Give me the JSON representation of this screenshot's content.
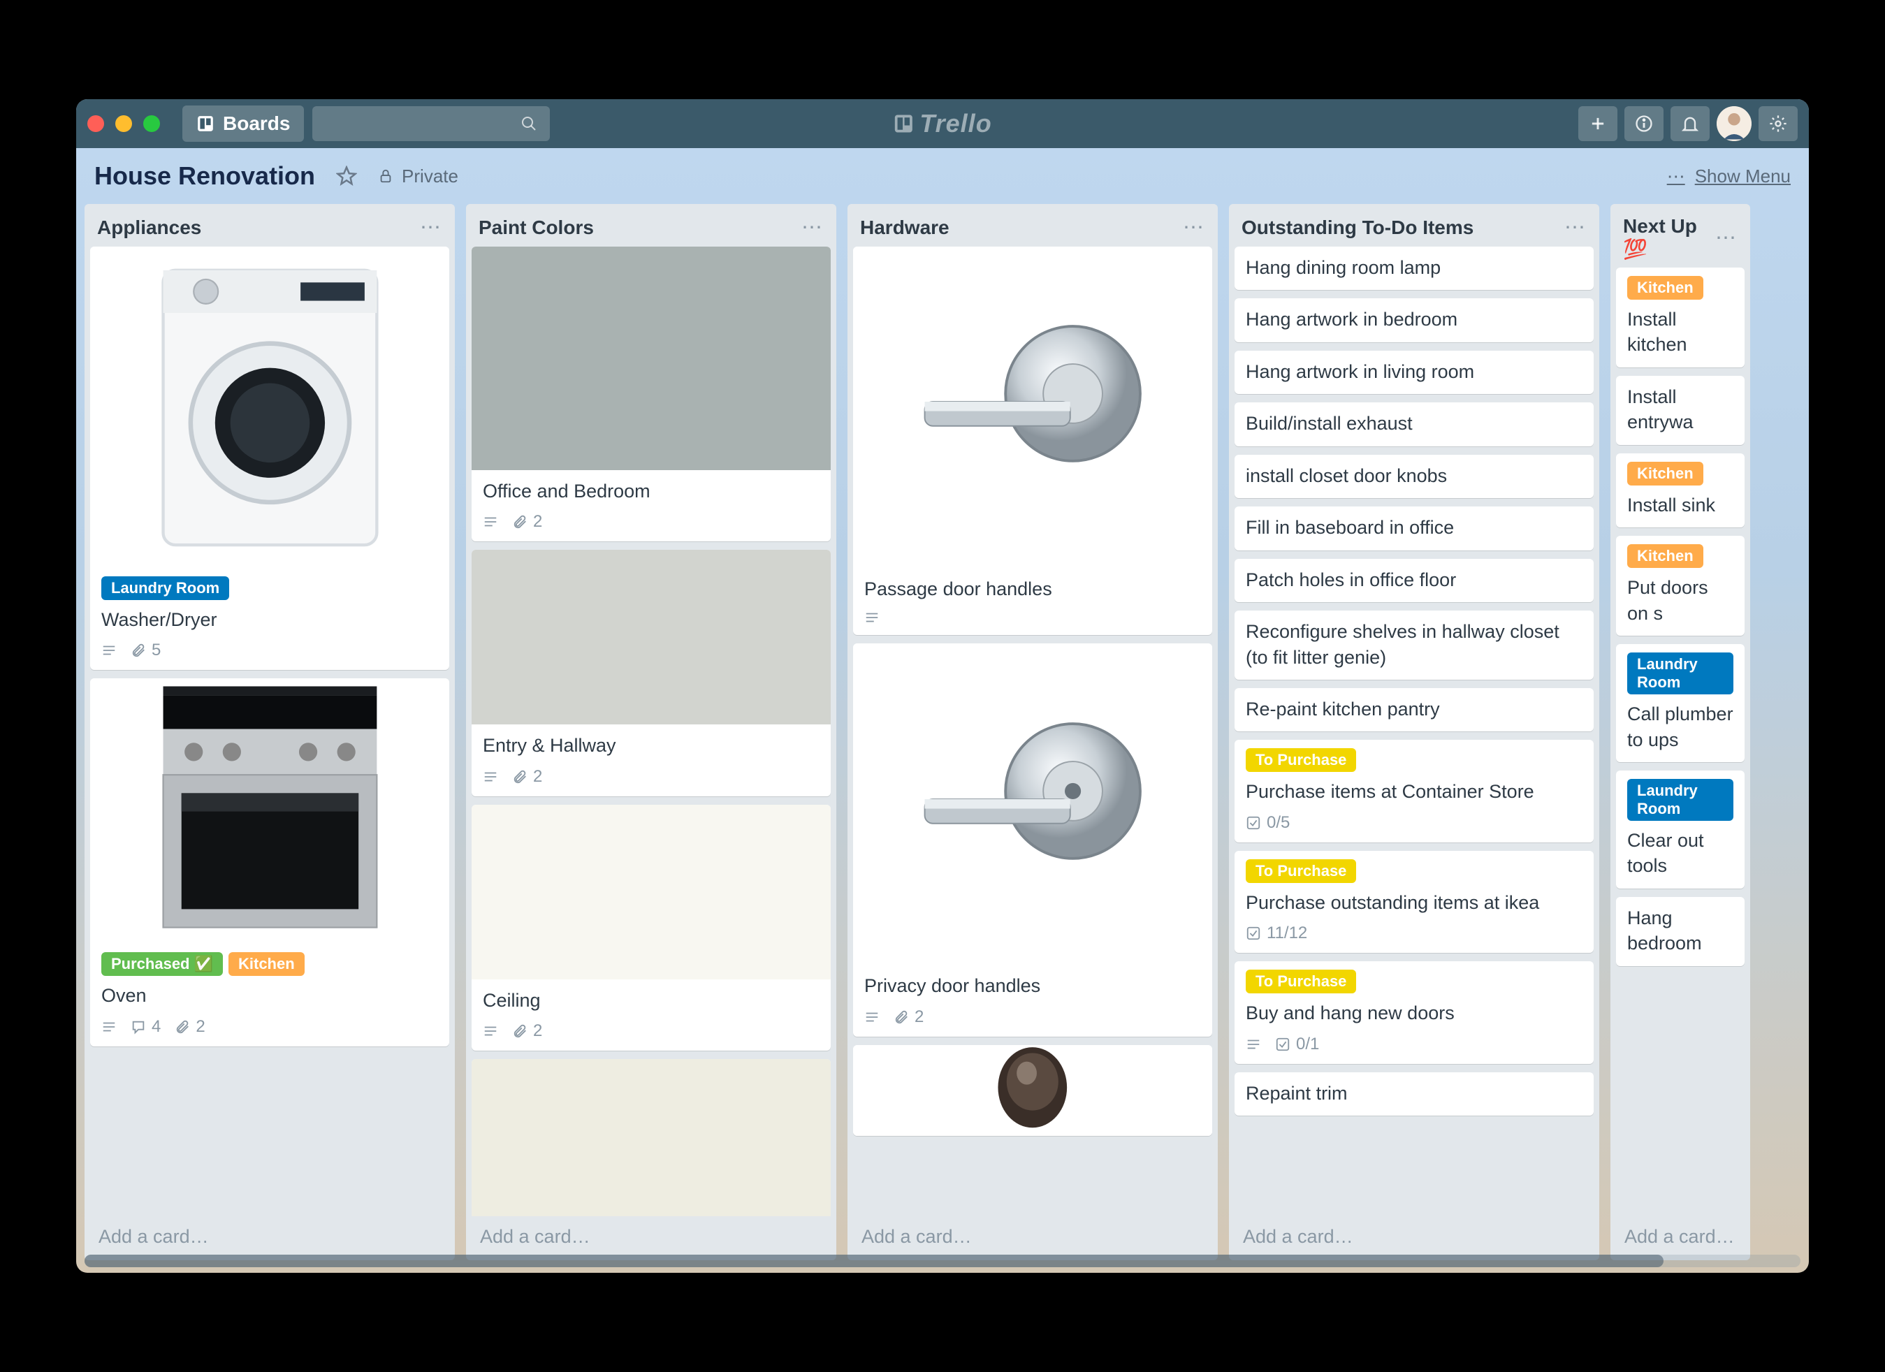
{
  "header": {
    "boards_label": "Boards",
    "logo_text": "Trello"
  },
  "board": {
    "title": "House Renovation",
    "privacy": "Private",
    "show_menu": "Show Menu"
  },
  "label_colors": {
    "laundry_room": {
      "text": "Laundry Room",
      "bg": "#0079bf"
    },
    "purchased": {
      "text": "Purchased ✅",
      "bg": "#61bd4f"
    },
    "kitchen": {
      "text": "Kitchen",
      "bg": "#ffab4a"
    },
    "to_purchase": {
      "text": "To Purchase",
      "bg": "#f2d600"
    }
  },
  "add_card": "Add a card…",
  "lists": [
    {
      "title": "Appliances",
      "cards": [
        {
          "cover": "washer",
          "labels": [
            "laundry_room"
          ],
          "title": "Washer/Dryer",
          "desc": true,
          "attachments": 5
        },
        {
          "cover": "oven",
          "labels": [
            "purchased",
            "kitchen"
          ],
          "title": "Oven",
          "desc": true,
          "comments": 4,
          "attachments": 2
        }
      ]
    },
    {
      "title": "Paint Colors",
      "cards": [
        {
          "cover_color": "#a9b2b1",
          "title": "Office and Bedroom",
          "desc": true,
          "attachments": 2
        },
        {
          "cover_color": "#d2d4cf",
          "cover_short": true,
          "title": "Entry & Hallway",
          "desc": true,
          "attachments": 2
        },
        {
          "cover_color": "#f8f7f1",
          "cover_short": true,
          "title": "Ceiling",
          "desc": true,
          "attachments": 2
        },
        {
          "cover_color": "#eeede1",
          "cover_short": true,
          "title": "",
          "desc": false
        }
      ]
    },
    {
      "title": "Hardware",
      "cards": [
        {
          "cover": "handle1",
          "title": "Passage door handles",
          "desc": true
        },
        {
          "cover": "handle2",
          "title": "Privacy door handles",
          "desc": true,
          "attachments": 2
        },
        {
          "cover": "knob",
          "cover_tiny": true
        }
      ]
    },
    {
      "title": "Outstanding To-Do Items",
      "cards": [
        {
          "title": "Hang dining room lamp"
        },
        {
          "title": "Hang artwork in bedroom"
        },
        {
          "title": "Hang artwork in living room"
        },
        {
          "title": "Build/install exhaust"
        },
        {
          "title": "install closet door knobs"
        },
        {
          "title": "Fill in baseboard in office"
        },
        {
          "title": "Patch holes in office floor"
        },
        {
          "title": "Reconfigure shelves in hallway closet (to fit litter genie)"
        },
        {
          "title": "Re-paint kitchen pantry"
        },
        {
          "labels": [
            "to_purchase"
          ],
          "title": "Purchase items at Container Store",
          "checklist": "0/5"
        },
        {
          "labels": [
            "to_purchase"
          ],
          "title": "Purchase outstanding items at ikea",
          "checklist": "11/12"
        },
        {
          "labels": [
            "to_purchase"
          ],
          "title": "Buy and hang new doors",
          "desc": true,
          "checklist": "0/1"
        },
        {
          "title": "Repaint trim"
        }
      ]
    },
    {
      "title": "Next Up 💯",
      "narrow": true,
      "cards": [
        {
          "labels": [
            "kitchen"
          ],
          "title": "Install kitchen"
        },
        {
          "title": "Install entrywa"
        },
        {
          "labels": [
            "kitchen"
          ],
          "title": "Install sink"
        },
        {
          "labels": [
            "kitchen"
          ],
          "title": "Put doors on s"
        },
        {
          "labels": [
            "laundry_room"
          ],
          "title": "Call plumber to ups",
          "multiline": true
        },
        {
          "labels": [
            "laundry_room"
          ],
          "title": "Clear out tools"
        },
        {
          "title": "Hang bedroom"
        }
      ]
    }
  ]
}
